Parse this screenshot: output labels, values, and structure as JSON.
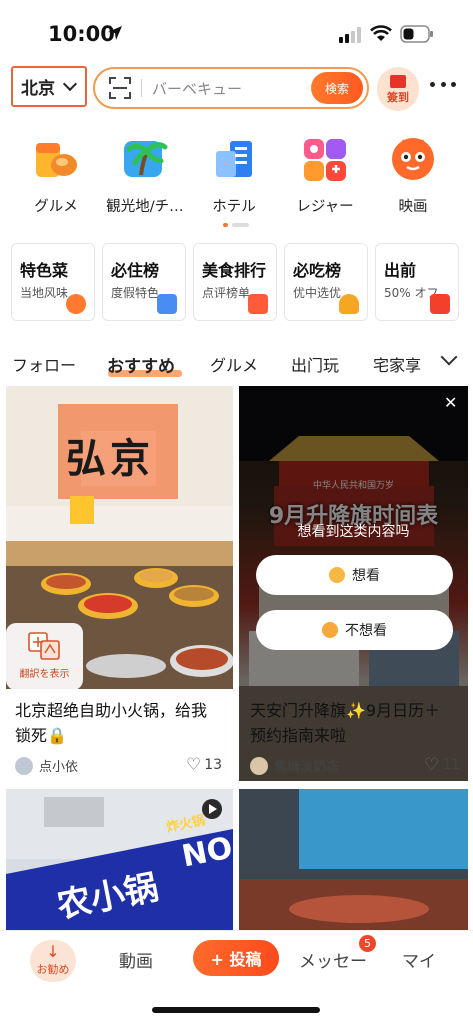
{
  "status_bar": {
    "time": "10:00"
  },
  "header": {
    "city": "北京",
    "search_placeholder": "バーベキュー",
    "search_button": "検索",
    "signin_label": "簽到"
  },
  "categories": [
    {
      "label": "グルメ",
      "icon": "food-icon"
    },
    {
      "label": "観光地/チ…",
      "icon": "palm-tree-icon"
    },
    {
      "label": "ホテル",
      "icon": "hotel-icon"
    },
    {
      "label": "レジャー",
      "icon": "leisure-icon"
    },
    {
      "label": "映画",
      "icon": "movie-cat-icon"
    }
  ],
  "features": [
    {
      "title": "特色菜",
      "sub": "当地风味"
    },
    {
      "title": "必住榜",
      "sub": "度假特色"
    },
    {
      "title": "美食排行",
      "sub": "点评榜单"
    },
    {
      "title": "必吃榜",
      "sub": "优中选优"
    },
    {
      "title": "出前",
      "sub": "50% オフ"
    }
  ],
  "tabs": [
    "フォロー",
    "おすすめ",
    "グルメ",
    "出门玩",
    "宅家享"
  ],
  "feed": {
    "card1": {
      "title_line1": "北京超绝自助小火锅，给我",
      "title_line2": "锁死🔒",
      "author": "点小依",
      "likes": "13",
      "translate": "翻訳を表示",
      "sign_text": "弘京"
    },
    "card2": {
      "title_line1": "天安门升降旗✨9月日历＋",
      "title_line2": "预约指南来啦",
      "author": "焦糖淡奶冻",
      "likes": "11",
      "poster": "9月升降旗时间表",
      "banner": "中华人民共和国万岁"
    },
    "card3": {
      "sign": "农小锅",
      "sign2": "NO",
      "sign3": "炸火锅"
    },
    "overlay": {
      "prompt": "想看到这类内容吗",
      "want": "想看",
      "not_want": "不想看"
    }
  },
  "tabbar": {
    "home": "お勧め",
    "video": "動画",
    "post": "+ 投稿",
    "message": "メッセー",
    "message_badge": "5",
    "mine": "マイ"
  },
  "colors": {
    "accent": "#ff5a1f",
    "brand_orange": "#f07a3a"
  }
}
